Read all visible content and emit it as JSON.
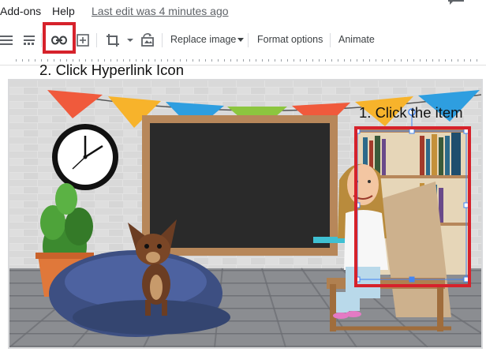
{
  "menu": {
    "items": [
      {
        "label": "Add-ons"
      },
      {
        "label": "Help"
      }
    ],
    "last_edit": "Last edit was 4 minutes ago"
  },
  "toolbar": {
    "replace_image": "Replace image",
    "format_options": "Format options",
    "animate": "Animate",
    "icons": [
      "align-icon",
      "distribute-icon",
      "link-icon",
      "add-comment-icon",
      "crop-icon",
      "crop-dropdown-icon",
      "reset-image-icon"
    ]
  },
  "annotations": {
    "step1": "1. Click the item",
    "step2": "2. Click Hyperlink Icon",
    "highlight_color": "#d6222b"
  },
  "slide": {
    "scene": "classroom-bitmoji",
    "colors": {
      "wall": "#dcdcdc",
      "floor": "#8a8a8a",
      "chalkboard": "#2a2a2a",
      "board_frame": "#b7875a",
      "beanbag": "#3d4f82"
    },
    "bunting_colors": [
      "#f05a3c",
      "#f7b32b",
      "#2e9ee0",
      "#8cc63f",
      "#f05a3c",
      "#f7b32b",
      "#2e9ee0"
    ]
  }
}
